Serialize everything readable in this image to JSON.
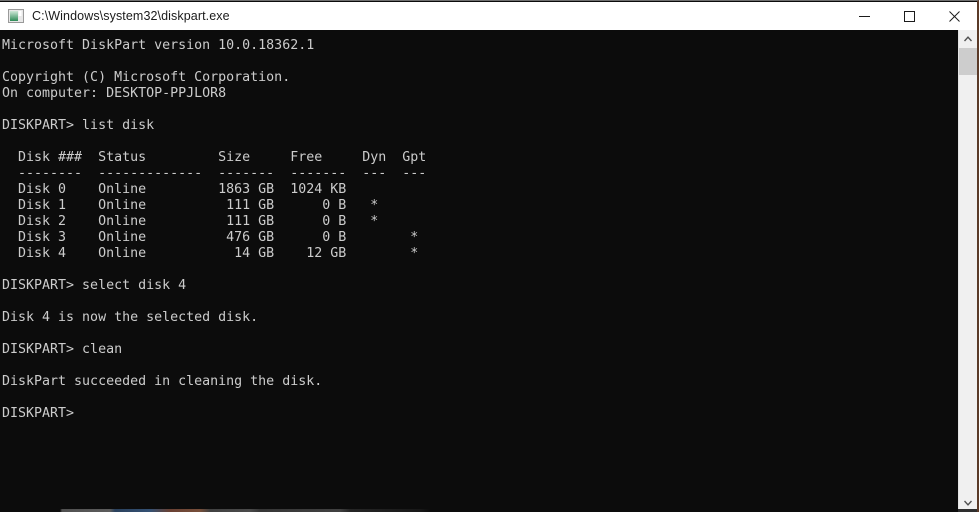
{
  "window": {
    "title": "C:\\Windows\\system32\\diskpart.exe",
    "icon": "console-window-icon",
    "background_color": "#0c0c0c",
    "titlebar_color": "#ffffff",
    "text_color": "#cccccc"
  },
  "window_controls": {
    "minimize_label": "—",
    "maximize_label": "☐",
    "close_label": "✕",
    "minimize_name": "minimize-button",
    "maximize_name": "maximize-button",
    "close_name": "close-button"
  },
  "scrollbar": {
    "up_arrow": "⌃",
    "down_arrow": "⌄",
    "thumb_position_percent": 4
  },
  "console": {
    "header": {
      "product_line": "Microsoft DiskPart version 10.0.18362.1",
      "copyright_line": "Copyright (C) Microsoft Corporation.",
      "computer_line": "On computer: DESKTOP-PPJLOR8"
    },
    "prompt": "DISKPART>",
    "commands": [
      "list disk",
      "select disk 4",
      "clean"
    ],
    "messages": [
      "Disk 4 is now the selected disk.",
      "DiskPart succeeded in cleaning the disk."
    ],
    "disk_table": {
      "headers": [
        "Disk ###",
        "Status",
        "Size",
        "Free",
        "Dyn",
        "Gpt"
      ],
      "separators": [
        "--------",
        "-------------",
        "-------",
        "-------",
        "---",
        "---"
      ],
      "rows": [
        {
          "disk": "Disk 0",
          "status": "Online",
          "size": "1863 GB",
          "free": "1024 KB",
          "dyn": "",
          "gpt": ""
        },
        {
          "disk": "Disk 1",
          "status": "Online",
          "size": "111 GB",
          "free": "0 B",
          "dyn": "*",
          "gpt": ""
        },
        {
          "disk": "Disk 2",
          "status": "Online",
          "size": "111 GB",
          "free": "0 B",
          "dyn": "*",
          "gpt": ""
        },
        {
          "disk": "Disk 3",
          "status": "Online",
          "size": "476 GB",
          "free": "0 B",
          "dyn": "",
          "gpt": "*"
        },
        {
          "disk": "Disk 4",
          "status": "Online",
          "size": "14 GB",
          "free": "12 GB",
          "dyn": "",
          "gpt": "*"
        }
      ]
    },
    "full_text": "Microsoft DiskPart version 10.0.18362.1\n\nCopyright (C) Microsoft Corporation.\nOn computer: DESKTOP-PPJLOR8\n\nDISKPART> list disk\n\n  Disk ###  Status         Size     Free     Dyn  Gpt\n  --------  -------------  -------  -------  ---  ---\n  Disk 0    Online         1863 GB  1024 KB\n  Disk 1    Online          111 GB      0 B   *\n  Disk 2    Online          111 GB      0 B   *\n  Disk 3    Online          476 GB      0 B        *\n  Disk 4    Online           14 GB    12 GB        *\n\nDISKPART> select disk 4\n\nDisk 4 is now the selected disk.\n\nDISKPART> clean\n\nDiskPart succeeded in cleaning the disk.\n\nDISKPART>"
  }
}
